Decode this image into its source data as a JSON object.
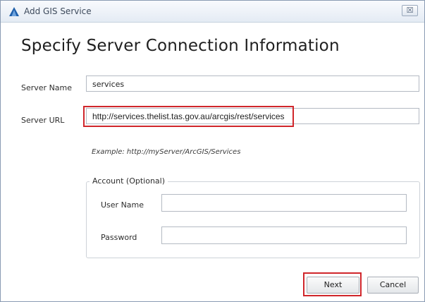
{
  "window": {
    "title": "Add GIS Service",
    "close_glyph": "☒",
    "icon": "arcgis-app-icon",
    "close_icon": "close-icon"
  },
  "heading": "Specify Server Connection Information",
  "server_name": {
    "label": "Server Name",
    "value": "services"
  },
  "server_url": {
    "label": "Server URL",
    "value": "http://services.thelist.tas.gov.au/arcgis/rest/services",
    "highlighted": true
  },
  "example_text": "Example: http://myServer/ArcGIS/Services",
  "account": {
    "legend": "Account (Optional)",
    "user_name": {
      "label": "User Name",
      "value": ""
    },
    "password": {
      "label": "Password",
      "value": ""
    }
  },
  "buttons": {
    "next": "Next",
    "cancel": "Cancel",
    "next_highlighted": true
  },
  "colors": {
    "highlight": "#d0262b",
    "titlebar": "#e4ebf4",
    "brand": "#1f5faa"
  }
}
